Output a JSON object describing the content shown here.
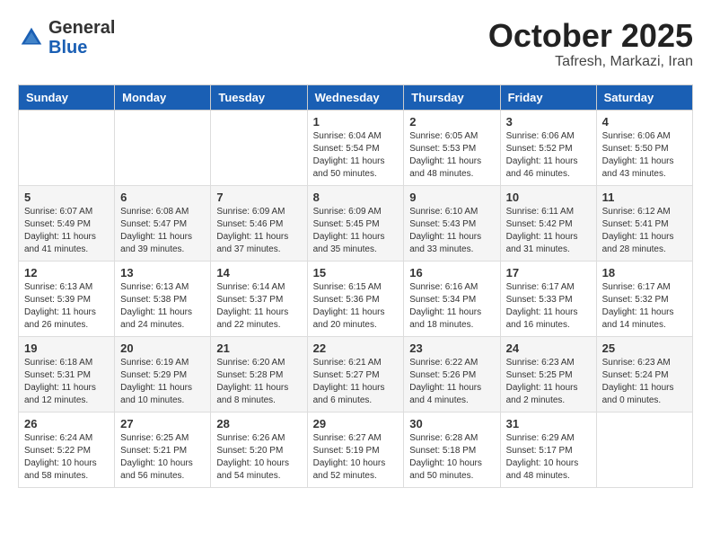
{
  "logo": {
    "general": "General",
    "blue": "Blue"
  },
  "header": {
    "month": "October 2025",
    "location": "Tafresh, Markazi, Iran"
  },
  "weekdays": [
    "Sunday",
    "Monday",
    "Tuesday",
    "Wednesday",
    "Thursday",
    "Friday",
    "Saturday"
  ],
  "weeks": [
    [
      {
        "day": "",
        "info": ""
      },
      {
        "day": "",
        "info": ""
      },
      {
        "day": "",
        "info": ""
      },
      {
        "day": "1",
        "info": "Sunrise: 6:04 AM\nSunset: 5:54 PM\nDaylight: 11 hours\nand 50 minutes."
      },
      {
        "day": "2",
        "info": "Sunrise: 6:05 AM\nSunset: 5:53 PM\nDaylight: 11 hours\nand 48 minutes."
      },
      {
        "day": "3",
        "info": "Sunrise: 6:06 AM\nSunset: 5:52 PM\nDaylight: 11 hours\nand 46 minutes."
      },
      {
        "day": "4",
        "info": "Sunrise: 6:06 AM\nSunset: 5:50 PM\nDaylight: 11 hours\nand 43 minutes."
      }
    ],
    [
      {
        "day": "5",
        "info": "Sunrise: 6:07 AM\nSunset: 5:49 PM\nDaylight: 11 hours\nand 41 minutes."
      },
      {
        "day": "6",
        "info": "Sunrise: 6:08 AM\nSunset: 5:47 PM\nDaylight: 11 hours\nand 39 minutes."
      },
      {
        "day": "7",
        "info": "Sunrise: 6:09 AM\nSunset: 5:46 PM\nDaylight: 11 hours\nand 37 minutes."
      },
      {
        "day": "8",
        "info": "Sunrise: 6:09 AM\nSunset: 5:45 PM\nDaylight: 11 hours\nand 35 minutes."
      },
      {
        "day": "9",
        "info": "Sunrise: 6:10 AM\nSunset: 5:43 PM\nDaylight: 11 hours\nand 33 minutes."
      },
      {
        "day": "10",
        "info": "Sunrise: 6:11 AM\nSunset: 5:42 PM\nDaylight: 11 hours\nand 31 minutes."
      },
      {
        "day": "11",
        "info": "Sunrise: 6:12 AM\nSunset: 5:41 PM\nDaylight: 11 hours\nand 28 minutes."
      }
    ],
    [
      {
        "day": "12",
        "info": "Sunrise: 6:13 AM\nSunset: 5:39 PM\nDaylight: 11 hours\nand 26 minutes."
      },
      {
        "day": "13",
        "info": "Sunrise: 6:13 AM\nSunset: 5:38 PM\nDaylight: 11 hours\nand 24 minutes."
      },
      {
        "day": "14",
        "info": "Sunrise: 6:14 AM\nSunset: 5:37 PM\nDaylight: 11 hours\nand 22 minutes."
      },
      {
        "day": "15",
        "info": "Sunrise: 6:15 AM\nSunset: 5:36 PM\nDaylight: 11 hours\nand 20 minutes."
      },
      {
        "day": "16",
        "info": "Sunrise: 6:16 AM\nSunset: 5:34 PM\nDaylight: 11 hours\nand 18 minutes."
      },
      {
        "day": "17",
        "info": "Sunrise: 6:17 AM\nSunset: 5:33 PM\nDaylight: 11 hours\nand 16 minutes."
      },
      {
        "day": "18",
        "info": "Sunrise: 6:17 AM\nSunset: 5:32 PM\nDaylight: 11 hours\nand 14 minutes."
      }
    ],
    [
      {
        "day": "19",
        "info": "Sunrise: 6:18 AM\nSunset: 5:31 PM\nDaylight: 11 hours\nand 12 minutes."
      },
      {
        "day": "20",
        "info": "Sunrise: 6:19 AM\nSunset: 5:29 PM\nDaylight: 11 hours\nand 10 minutes."
      },
      {
        "day": "21",
        "info": "Sunrise: 6:20 AM\nSunset: 5:28 PM\nDaylight: 11 hours\nand 8 minutes."
      },
      {
        "day": "22",
        "info": "Sunrise: 6:21 AM\nSunset: 5:27 PM\nDaylight: 11 hours\nand 6 minutes."
      },
      {
        "day": "23",
        "info": "Sunrise: 6:22 AM\nSunset: 5:26 PM\nDaylight: 11 hours\nand 4 minutes."
      },
      {
        "day": "24",
        "info": "Sunrise: 6:23 AM\nSunset: 5:25 PM\nDaylight: 11 hours\nand 2 minutes."
      },
      {
        "day": "25",
        "info": "Sunrise: 6:23 AM\nSunset: 5:24 PM\nDaylight: 11 hours\nand 0 minutes."
      }
    ],
    [
      {
        "day": "26",
        "info": "Sunrise: 6:24 AM\nSunset: 5:22 PM\nDaylight: 10 hours\nand 58 minutes."
      },
      {
        "day": "27",
        "info": "Sunrise: 6:25 AM\nSunset: 5:21 PM\nDaylight: 10 hours\nand 56 minutes."
      },
      {
        "day": "28",
        "info": "Sunrise: 6:26 AM\nSunset: 5:20 PM\nDaylight: 10 hours\nand 54 minutes."
      },
      {
        "day": "29",
        "info": "Sunrise: 6:27 AM\nSunset: 5:19 PM\nDaylight: 10 hours\nand 52 minutes."
      },
      {
        "day": "30",
        "info": "Sunrise: 6:28 AM\nSunset: 5:18 PM\nDaylight: 10 hours\nand 50 minutes."
      },
      {
        "day": "31",
        "info": "Sunrise: 6:29 AM\nSunset: 5:17 PM\nDaylight: 10 hours\nand 48 minutes."
      },
      {
        "day": "",
        "info": ""
      }
    ]
  ]
}
